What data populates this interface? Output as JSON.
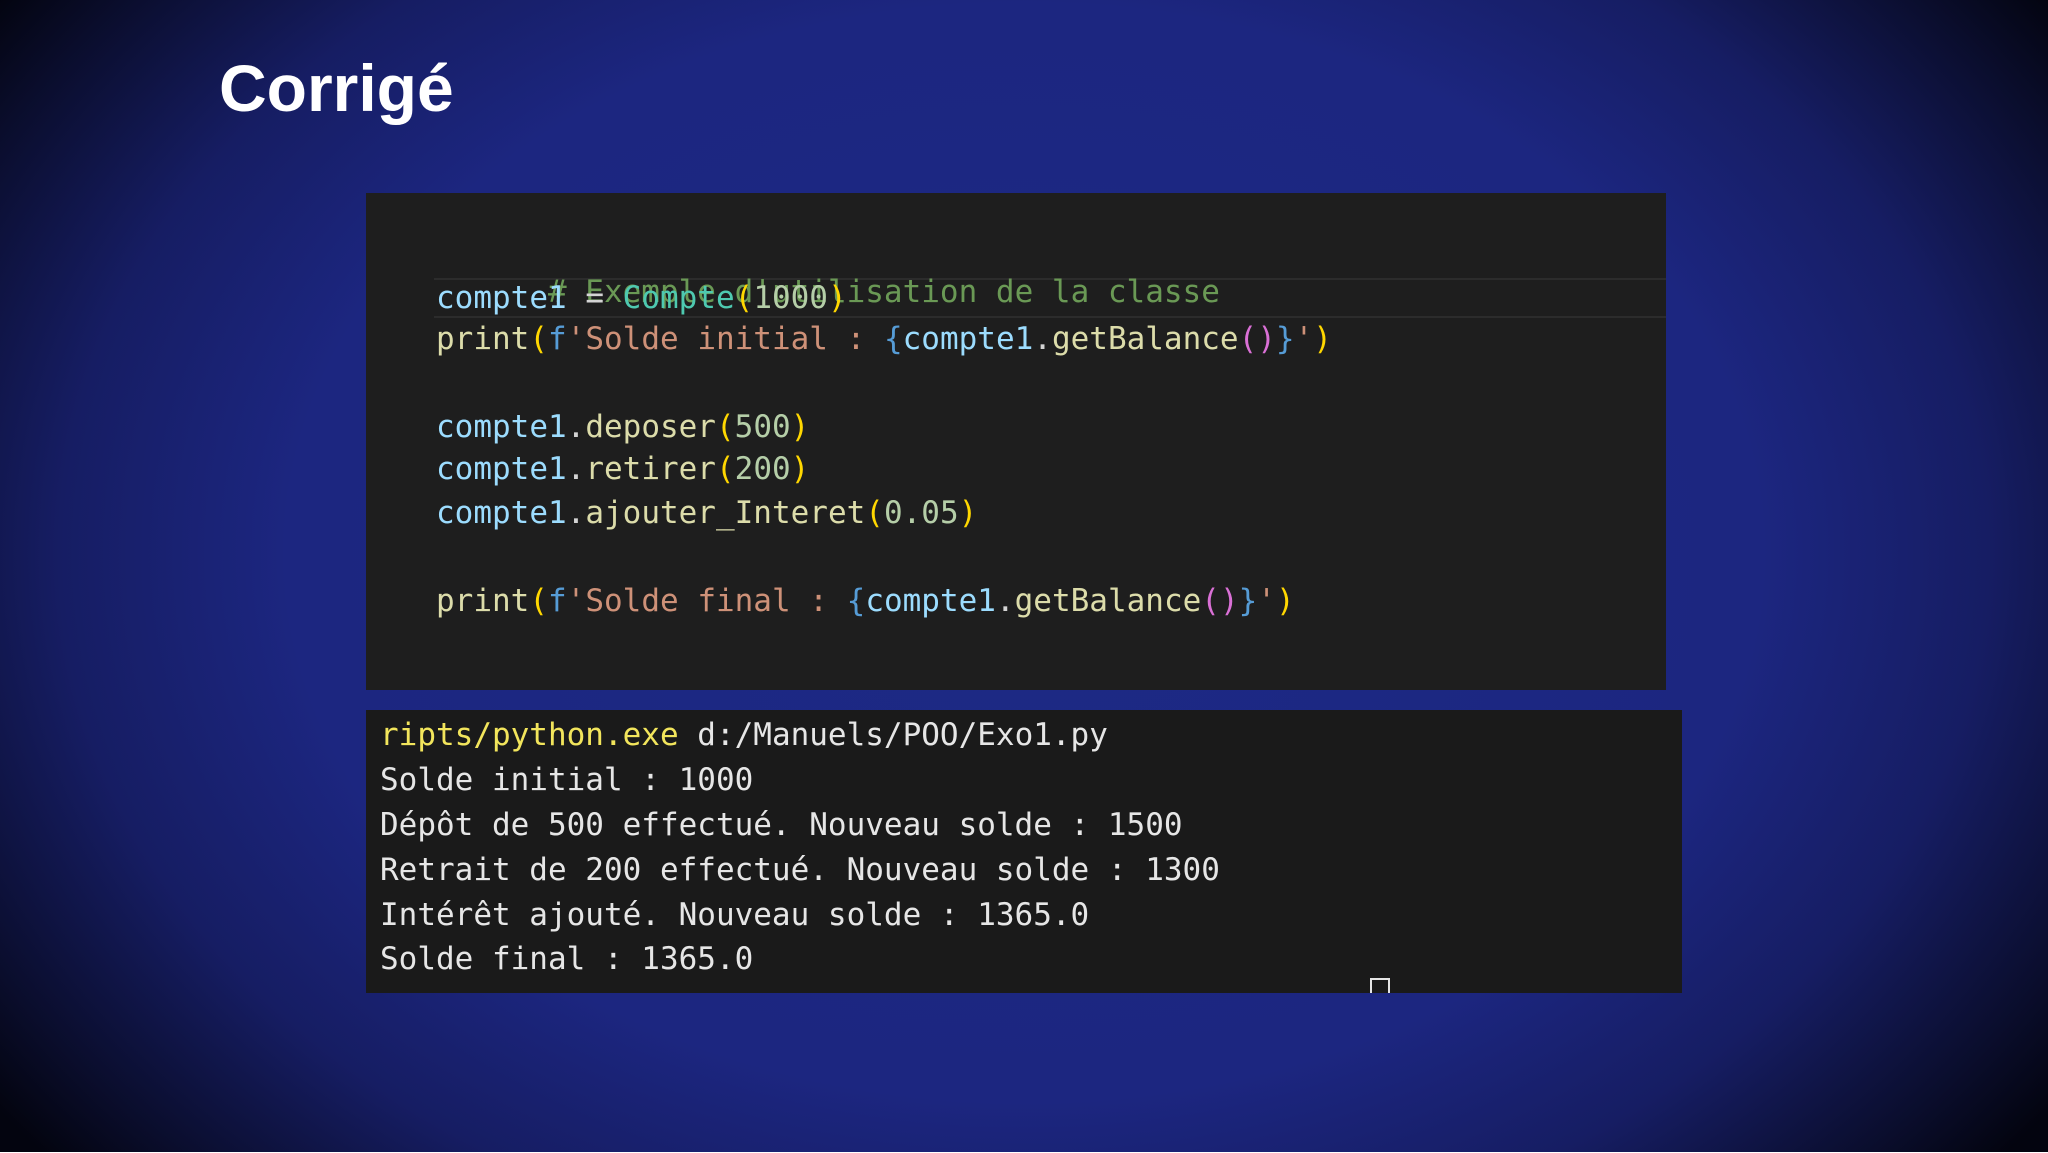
{
  "slide": {
    "title": "Corrigé"
  },
  "code": {
    "line1": {
      "comment": "# Exemple d'utilisation de la classe"
    },
    "line2": {
      "var": "compte1",
      "assign": " = ",
      "cls": "Compte",
      "open": "(",
      "num": "1000",
      "close": ")"
    },
    "line3": {
      "fn": "print",
      "open": "(",
      "prefix": "f",
      "str": "'Solde initial : ",
      "brace_open": "{",
      "expr_var": "compte1",
      "dot": ".",
      "method": "getBalance",
      "call": "()",
      "brace_close": "}",
      "str_end": "'",
      "close": ")"
    },
    "line4": {
      "var": "compte1",
      "dot": ".",
      "method": "deposer",
      "open": "(",
      "num": "500",
      "close": ")"
    },
    "line5": {
      "var": "compte1",
      "dot": ".",
      "method": "retirer",
      "open": "(",
      "num": "200",
      "close": ")"
    },
    "line6": {
      "var": "compte1",
      "dot": ".",
      "method": "ajouter_Interet",
      "open": "(",
      "num": "0.05",
      "close": ")"
    },
    "line7": {
      "fn": "print",
      "open": "(",
      "prefix": "f",
      "str": "'Solde final : ",
      "brace_open": "{",
      "expr_var": "compte1",
      "dot": ".",
      "method": "getBalance",
      "call": "()",
      "brace_close": "}",
      "str_end": "'",
      "close": ")"
    }
  },
  "terminal": {
    "command_exe": "ripts/python.exe",
    "command_arg": " d:/Manuels/POO/Exo1.py",
    "output": [
      "Solde initial : 1000",
      "Dépôt de 500 effectué. Nouveau solde : 1500",
      "Retrait de 200 effectué. Nouveau solde : 1300",
      "Intérêt ajouté. Nouveau solde : 1365.0",
      "Solde final : 1365.0"
    ]
  }
}
